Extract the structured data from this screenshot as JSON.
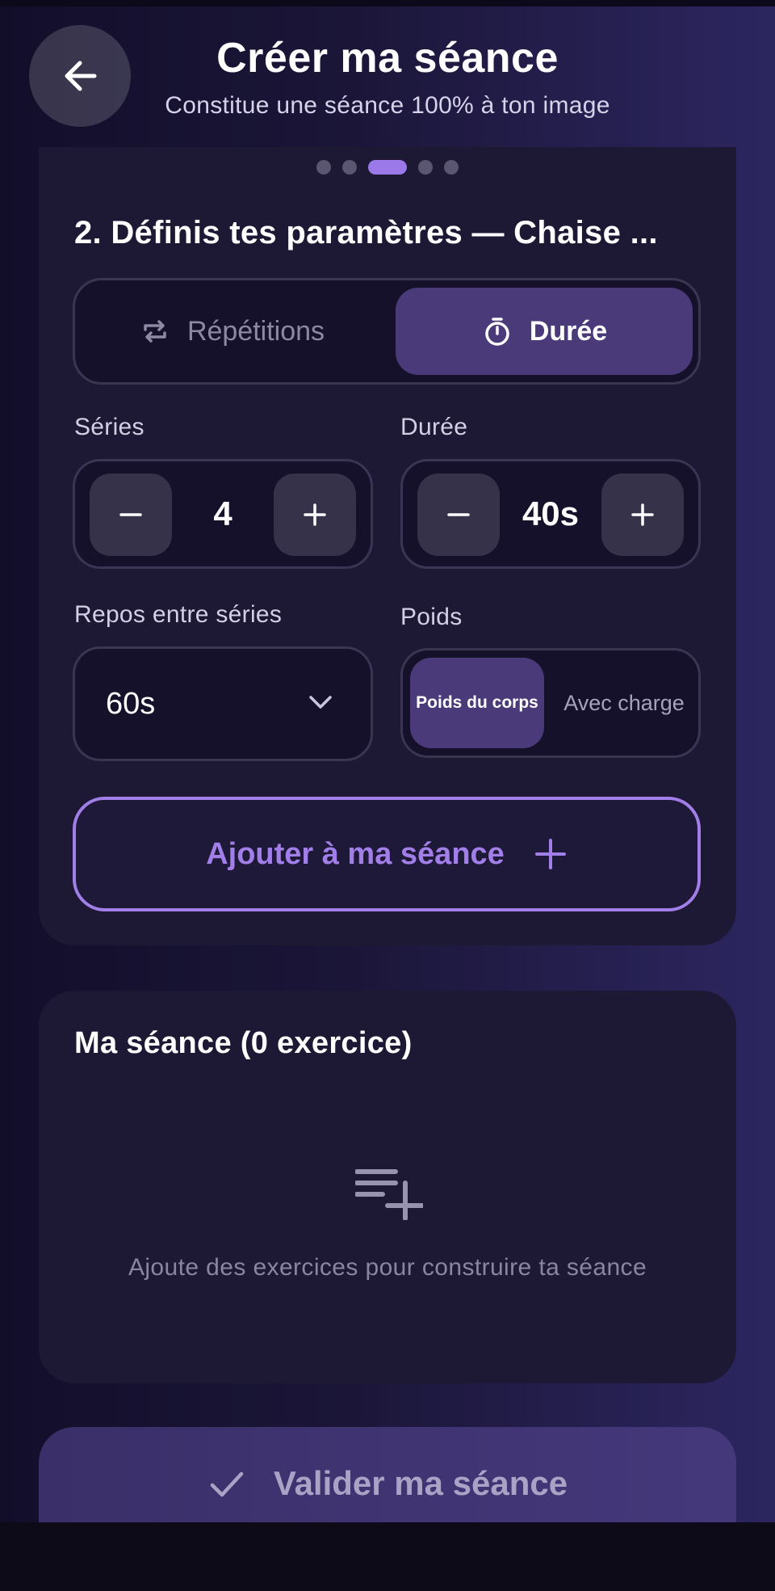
{
  "header": {
    "title": "Créer ma séance",
    "subtitle": "Constitue une séance 100% à ton image",
    "back_icon": "arrow-left-icon"
  },
  "progress": {
    "steps": 5,
    "current_step": 3
  },
  "params": {
    "section_title": "2.  Définis tes paramètres — Chaise ...",
    "mode_toggle": {
      "options": [
        {
          "label": "Répétitions",
          "icon": "repeat-icon",
          "selected": false
        },
        {
          "label": "Durée",
          "icon": "timer-icon",
          "selected": true
        }
      ]
    },
    "series": {
      "label": "Séries",
      "value": "4"
    },
    "duration": {
      "label": "Durée",
      "value": "40s"
    },
    "rest": {
      "label": "Repos entre séries",
      "value": "60s"
    },
    "weight": {
      "label": "Poids",
      "options": [
        {
          "label": "Poids du corps",
          "selected": true
        },
        {
          "label": "Avec charge",
          "selected": false
        }
      ]
    },
    "add_button": {
      "label": "Ajouter à ma séance",
      "icon": "plus-icon"
    }
  },
  "session": {
    "title": "Ma séance (0 exercice)",
    "empty_icon": "playlist-add-icon",
    "empty_text": "Ajoute des exercices pour construire ta séance"
  },
  "validate_button": {
    "label": "Valider ma séance",
    "icon": "check-icon"
  },
  "colors": {
    "accent": "#a27ee8",
    "selected_bg": "#4b3a7a",
    "card_bg": "#1d1834",
    "field_bg": "#15112a"
  }
}
